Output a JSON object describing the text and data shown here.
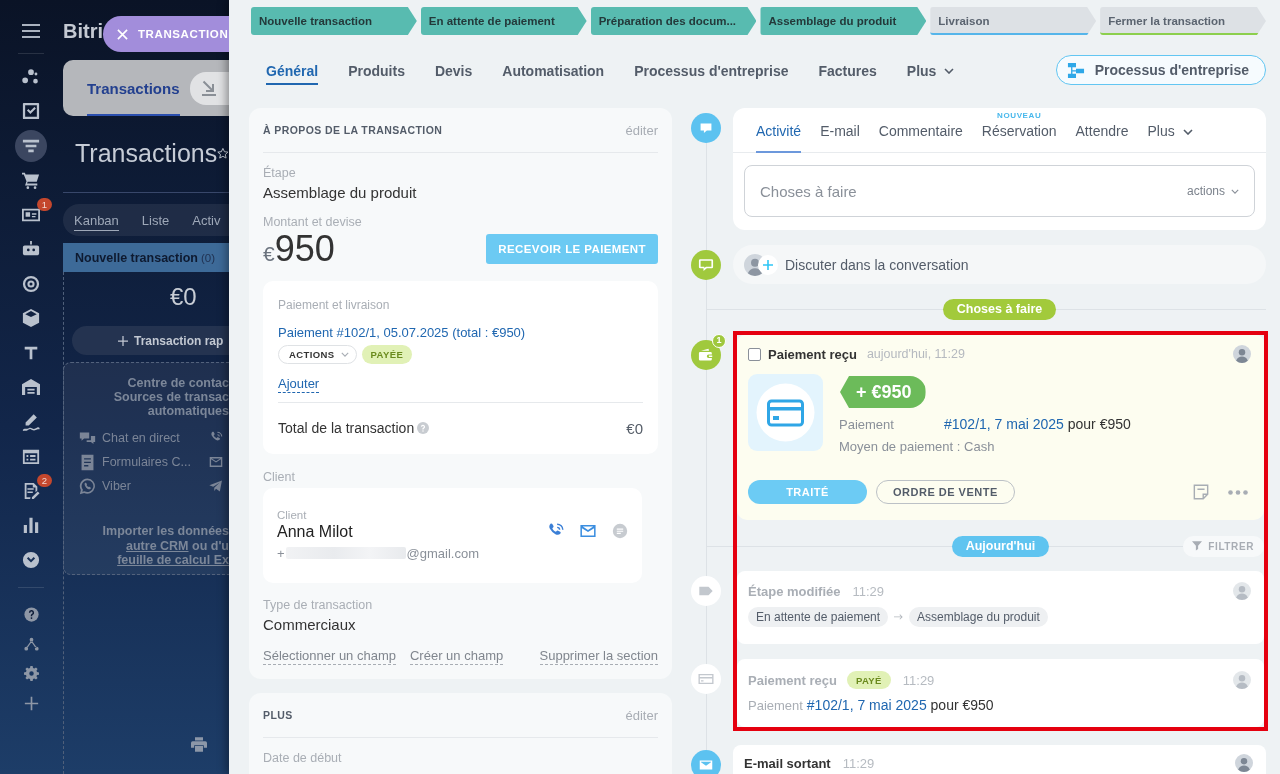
{
  "nav": {
    "items": [
      {
        "selected": false
      },
      {
        "selected": false
      },
      {
        "selected": true
      },
      {
        "selected": false
      },
      {
        "selected": false,
        "badge": "1"
      },
      {
        "selected": false
      },
      {
        "selected": false
      },
      {
        "selected": false
      },
      {
        "selected": false
      },
      {
        "selected": false
      },
      {
        "selected": false
      },
      {
        "selected": false
      },
      {
        "selected": false,
        "badge": "2"
      },
      {
        "selected": false
      },
      {
        "selected": false
      }
    ]
  },
  "crm": {
    "logo": "Bitri",
    "slider_tab": "TRANSACTION",
    "tabs": [
      {
        "label": "Transactions",
        "selected": true
      }
    ],
    "title": "Transactions",
    "views": [
      {
        "label": "Kanban",
        "selected": true
      },
      {
        "label": "Liste",
        "selected": false
      },
      {
        "label": "Activ",
        "selected": false
      }
    ],
    "column": {
      "title": "Nouvelle transaction",
      "count": "(0)",
      "total": "€0",
      "quick_add": "Transaction rap",
      "empty_lines": [
        "Centre de contac",
        "Sources de transac",
        "automatiques"
      ],
      "sources": [
        "Chat en direct",
        "Formulaires C...",
        "Viber"
      ],
      "import_lines": [
        [
          {
            "text": "Importer les données",
            "link": false
          }
        ],
        [
          {
            "text": "autre CRM",
            "link": true
          },
          {
            "text": " ou d'u",
            "link": false
          }
        ],
        [
          {
            "text": "feuille de calcul Ex",
            "link": true
          }
        ]
      ]
    }
  },
  "stages": [
    {
      "label": "Nouvelle transaction",
      "reached": true,
      "color": "#58bbb0"
    },
    {
      "label": "En attente de paiement",
      "reached": true,
      "color": "#58bbb0"
    },
    {
      "label": "Préparation des docum...",
      "reached": true,
      "color": "#58bbb0"
    },
    {
      "label": "Assemblage du produit",
      "reached": true,
      "color": "#58bbb0"
    },
    {
      "label": "Livraison",
      "reached": false,
      "color": "#55b5ea"
    },
    {
      "label": "Fermer la transaction",
      "reached": false,
      "color": "#8ccf4d"
    }
  ],
  "tabs": [
    {
      "label": "Général",
      "selected": true,
      "kind": "tab"
    },
    {
      "label": "Produits",
      "selected": false,
      "kind": "tab"
    },
    {
      "label": "Devis",
      "selected": false,
      "kind": "tab"
    },
    {
      "label": "Automatisation",
      "selected": false,
      "kind": "tab"
    },
    {
      "label": "Processus d'entreprise",
      "selected": false,
      "kind": "tab"
    },
    {
      "label": "Factures",
      "selected": false,
      "kind": "tab"
    },
    {
      "label": "Plus",
      "selected": false,
      "kind": "menu"
    }
  ],
  "process_button": "Processus d'entreprise",
  "about": {
    "title": "À PROPOS DE LA TRANSACTION",
    "edit": "éditer",
    "stage_label": "Étape",
    "stage_value": "Assemblage du produit",
    "amount_label": "Montant et devise",
    "currency": "€",
    "amount": "950",
    "receive_button": "RECEVOIR LE PAIEMENT",
    "payment": {
      "title": "Paiement et livraison",
      "link": "Paiement #102/1, 05.07.2025 (total : €950)",
      "actions": "ACTIONS",
      "status": "PAYÉE",
      "add": "Ajouter",
      "total_label": "Total de la transaction",
      "total_value": "€0"
    },
    "client_label": "Client",
    "client": {
      "role": "Client",
      "name": "Anna Milot",
      "contact_start": "+",
      "contact_end": "@gmail.com"
    },
    "type_label": "Type de transaction",
    "type_value": "Commerciaux",
    "actions": [
      "Sélectionner un champ",
      "Créer un champ",
      "Supprimer la section"
    ]
  },
  "more": {
    "title": "PLUS",
    "edit": "éditer",
    "date_label": "Date de début"
  },
  "timeline": {
    "composer": {
      "tabs": [
        {
          "label": "Activité",
          "selected": true,
          "kind": "tab"
        },
        {
          "label": "E-mail",
          "selected": false,
          "kind": "tab"
        },
        {
          "label": "Commentaire",
          "selected": false,
          "kind": "tab"
        },
        {
          "label": "Réservation",
          "selected": false,
          "kind": "tab",
          "badge": "NOUVEAU"
        },
        {
          "label": "Attendre",
          "selected": false,
          "kind": "tab"
        },
        {
          "label": "Plus",
          "selected": false,
          "kind": "menu"
        }
      ],
      "placeholder": "Choses à faire",
      "actions": "actions"
    },
    "chat": "Discuter dans la conversation",
    "todo_label": "Choses à faire",
    "framed": true,
    "activity": {
      "checked": false,
      "title": "Paiement reçu",
      "time": "aujourd'hui, 11:29",
      "counter": "1",
      "amount": "+ €950",
      "label": "Paiement",
      "link": "#102/1, 7 mai 2025",
      "suffix": "pour €950",
      "method": "Moyen de paiement : Cash",
      "buttons": [
        {
          "label": "TRAITÉ",
          "kind": "primary"
        },
        {
          "label": "ORDRE DE VENTE",
          "kind": "secondary"
        }
      ]
    },
    "today_label": "Aujourd'hui",
    "filter": "FILTRER",
    "history": [
      {
        "kind": "stage",
        "title": "Étape modifiée",
        "time": "11:29",
        "from": "En attente de paiement",
        "to": "Assemblage du produit"
      },
      {
        "kind": "payment",
        "title": "Paiement reçu",
        "status": "PAYÉ",
        "time": "11:29",
        "label": "Paiement",
        "link": "#102/1, 7 mai 2025",
        "suffix": "pour €950"
      }
    ],
    "email": {
      "title": "E-mail sortant",
      "time": "11:29"
    }
  }
}
